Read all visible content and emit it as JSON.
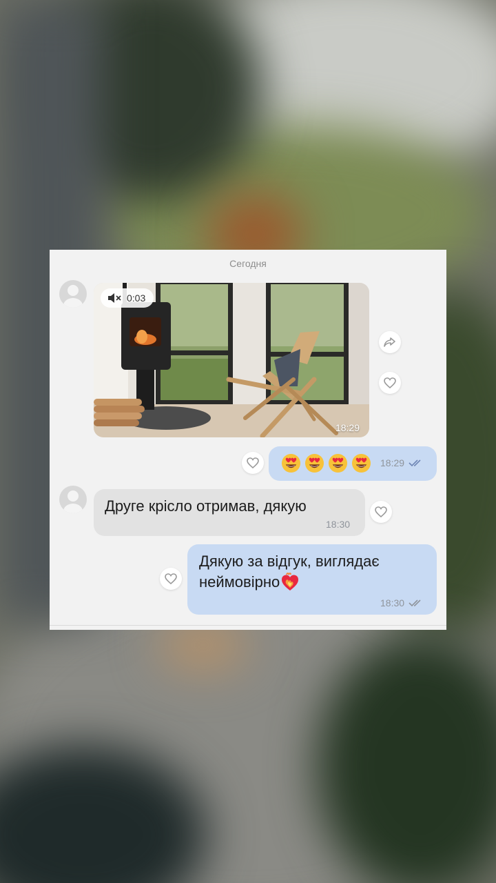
{
  "chat": {
    "date_separator": "Сегодня",
    "video": {
      "duration": "0:03",
      "time": "18:29"
    },
    "messages": [
      {
        "side": "out",
        "emoji_count": 4,
        "time": "18:29",
        "status": "read"
      },
      {
        "side": "in",
        "text": "Друге крісло отримав, дякую",
        "time": "18:30"
      },
      {
        "side": "out",
        "text_line1": "Дякую за відгук, виглядає",
        "text_line2": "неймовірно",
        "trailing_emoji": "burning-heart-emoji",
        "time": "18:30",
        "status": "read"
      }
    ]
  },
  "colors": {
    "outgoing_bubble": "#c8daf3",
    "incoming_bubble": "#e2e2e2",
    "card_background": "#f2f2f2",
    "read_check": "#6f86b5"
  },
  "icons": {
    "muted": "speaker-muted-icon",
    "share": "share-arrow-icon",
    "like": "heart-outline-icon",
    "read": "double-check-icon"
  }
}
